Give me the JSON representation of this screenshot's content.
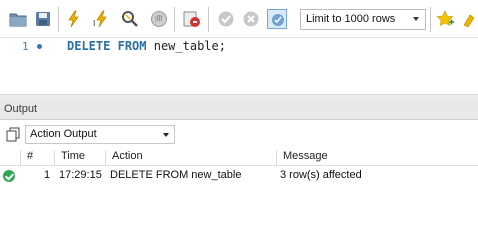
{
  "toolbar": {
    "buttons": [
      {
        "name": "open-folder-icon"
      },
      {
        "name": "save-icon"
      },
      {
        "name": "execute-lightning-icon"
      },
      {
        "name": "execute-cursor-lightning-icon"
      },
      {
        "name": "explain-magnifier-icon"
      },
      {
        "name": "stop-icon"
      },
      {
        "name": "toggle-error-stop-icon"
      },
      {
        "name": "commit-check-icon"
      },
      {
        "name": "rollback-cancel-icon"
      },
      {
        "name": "autocommit-toggle-icon"
      },
      {
        "name": "add-bookmark-star-icon"
      },
      {
        "name": "beautify-brush-icon"
      }
    ],
    "limit": {
      "selected": "Limit to 1000 rows"
    }
  },
  "editor": {
    "line_number": "1",
    "keyword1": "DELETE",
    "keyword2": "FROM",
    "identifier": "new_table;"
  },
  "output": {
    "title": "Output",
    "view_select": "Action Output",
    "columns": [
      "#",
      "Time",
      "Action",
      "Message"
    ],
    "rows": [
      {
        "status": "success",
        "num": "1",
        "time": "17:29:15",
        "action": "DELETE FROM new_table",
        "message": "3 row(s) affected"
      }
    ]
  },
  "colors": {
    "keyword": "#2a6fa8",
    "success": "#2fa84f",
    "panel_header": "#e8e8e8"
  }
}
